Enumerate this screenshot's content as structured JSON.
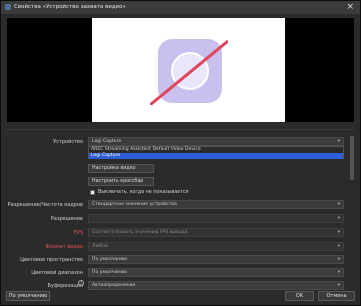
{
  "window": {
    "title": "Свойства «Устройство захвата видео»"
  },
  "device_dropdown": {
    "label": "Устройство",
    "value": "Logi Capture",
    "options": [
      "AREC Streaming Assistant Default Video Device",
      "Logi Capture"
    ],
    "selected_index": 1
  },
  "buttons": {
    "configure_video": "Настройка видео",
    "configure_crossbar": "Настроить кроссбар",
    "defaults": "По умолчанию",
    "ok": "OK",
    "cancel": "Отмена"
  },
  "checkbox_deactivate": {
    "label": "Выключать, когда не показывается",
    "checked": false
  },
  "rows": [
    {
      "label": "Разрешение/Частота кадров",
      "value": "Стандартное значение устройства",
      "red": false,
      "disabled": false
    },
    {
      "label": "Разрешение",
      "value": "",
      "red": false,
      "disabled": true
    },
    {
      "label": "FPS",
      "value": "Соответствовать значению FPS вывода",
      "red": true,
      "disabled": true
    },
    {
      "label": "Формат видео",
      "value": "Любой",
      "red": true,
      "disabled": true
    },
    {
      "label": "Цветовое пространство",
      "value": "По умолчанию",
      "red": false,
      "disabled": false
    },
    {
      "label": "Цветовой диапазон",
      "value": "По умолчанию",
      "red": false,
      "disabled": false
    },
    {
      "label": "Буферизация",
      "value": "Автоопределение",
      "red": false,
      "disabled": false
    }
  ],
  "colors": {
    "accent": "#2e5fd6",
    "warning_label": "#e05454",
    "preview_icon": "#c9c0ee",
    "preview_strike": "#e0475e"
  }
}
